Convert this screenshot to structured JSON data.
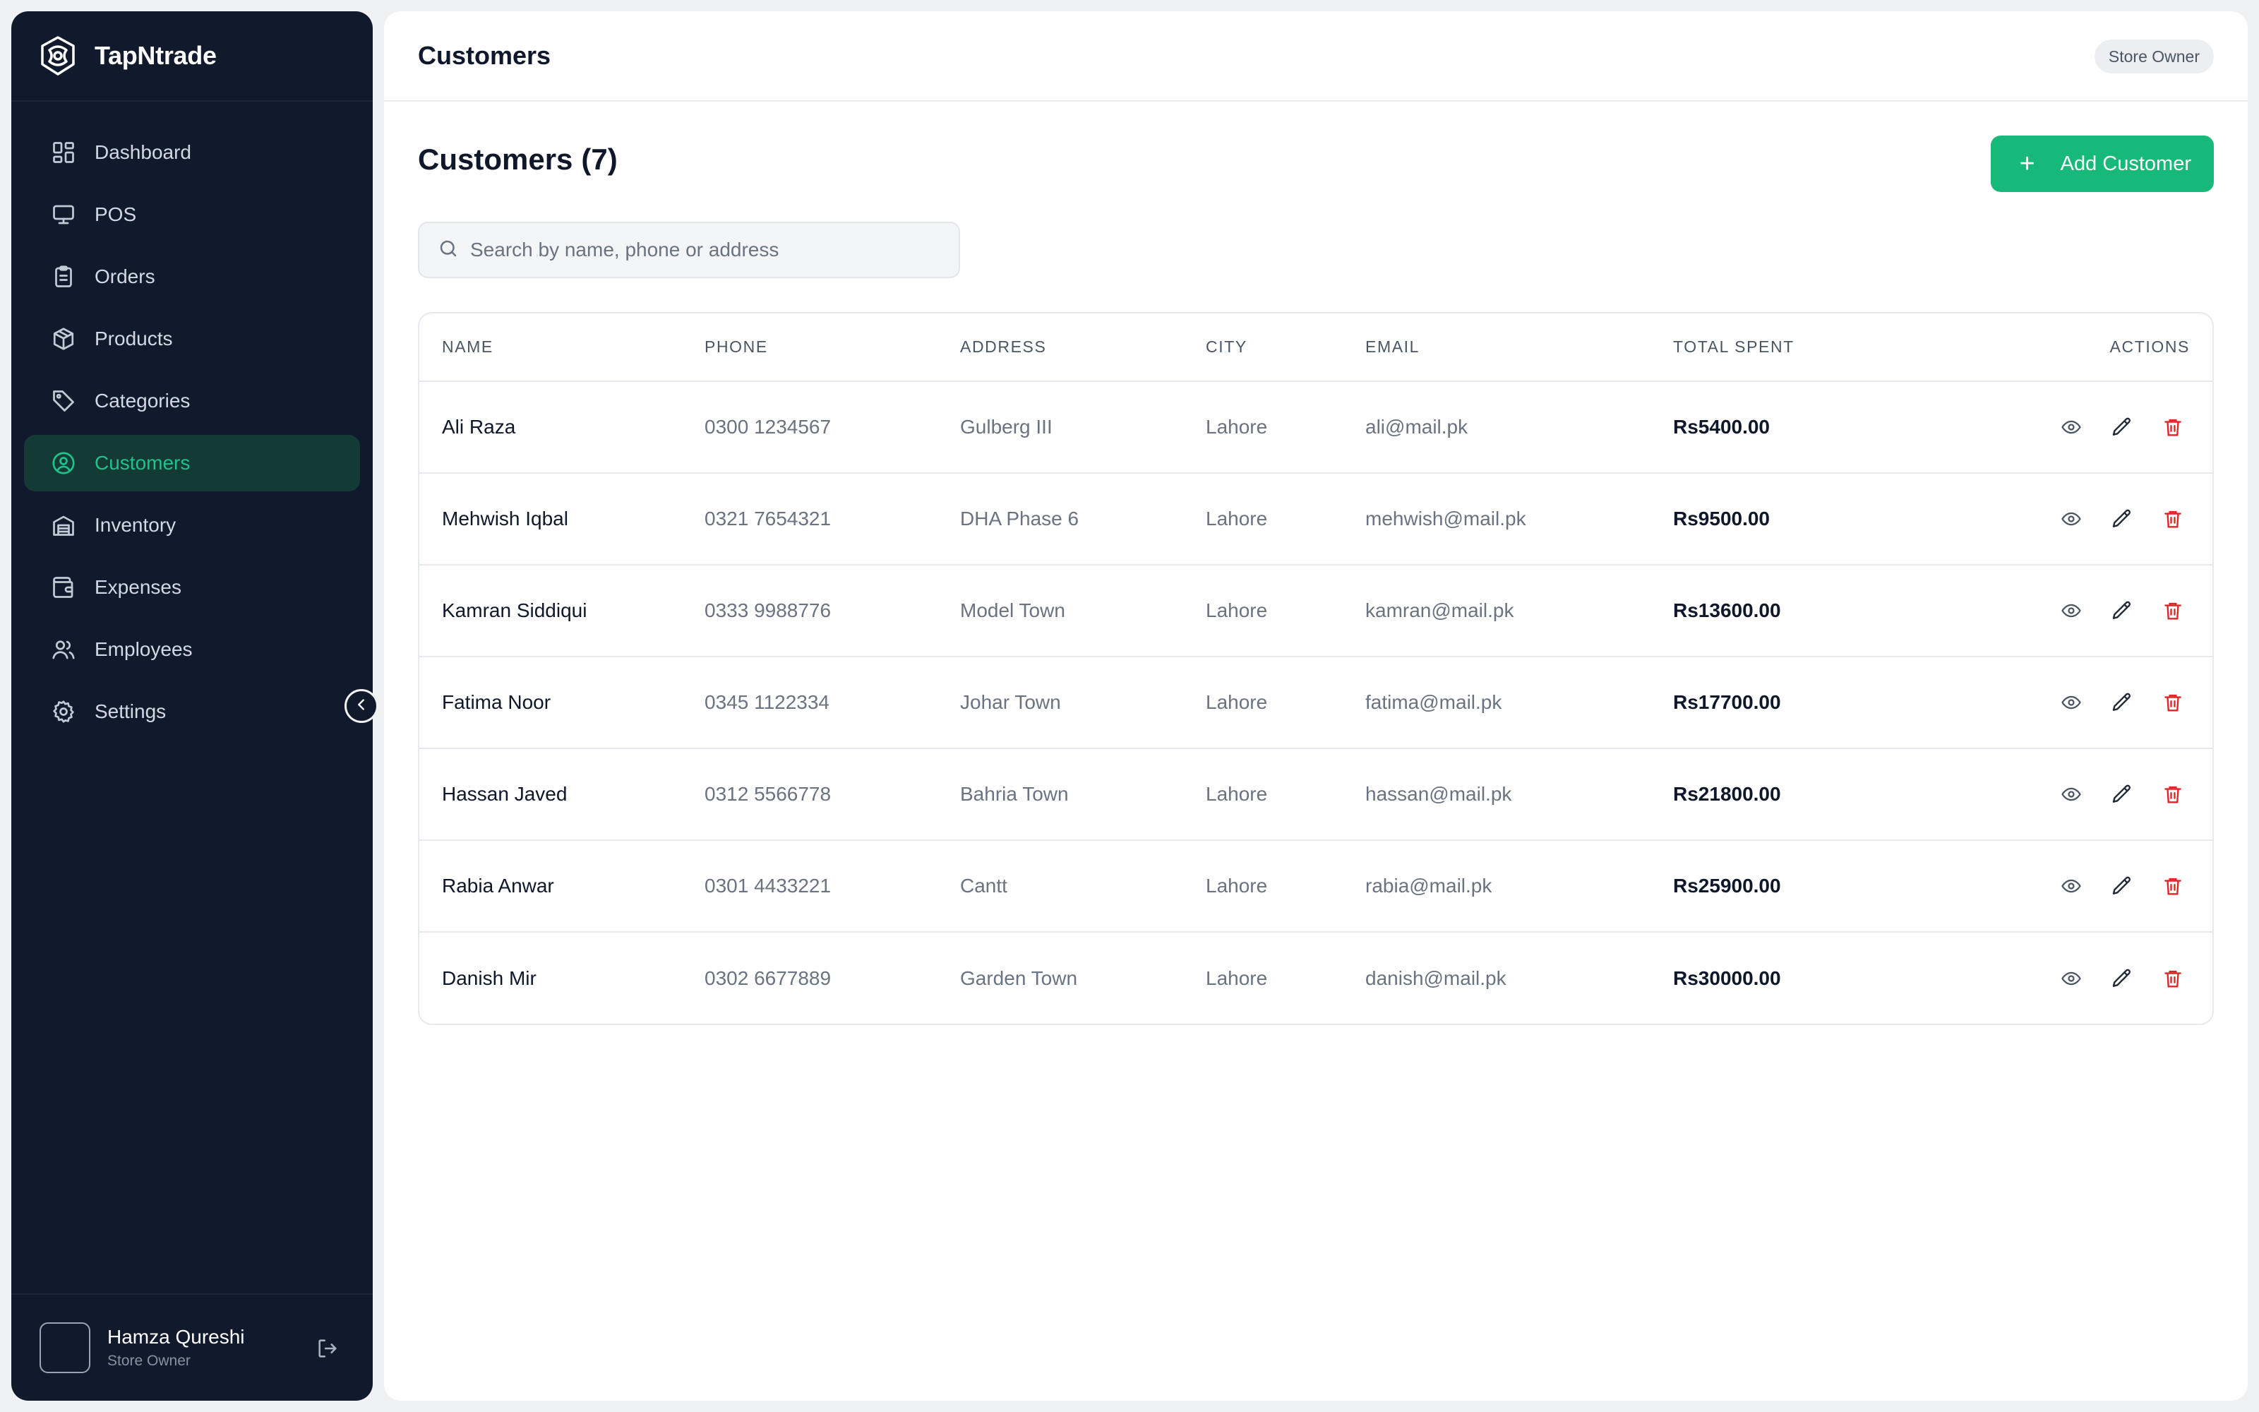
{
  "brand": {
    "name": "TapNtrade"
  },
  "nav": {
    "items": [
      {
        "label": "Dashboard",
        "icon": "dashboard-icon"
      },
      {
        "label": "POS",
        "icon": "monitor-icon"
      },
      {
        "label": "Orders",
        "icon": "clipboard-icon"
      },
      {
        "label": "Products",
        "icon": "package-icon"
      },
      {
        "label": "Categories",
        "icon": "tag-icon"
      },
      {
        "label": "Customers",
        "icon": "user-circle-icon",
        "active": true
      },
      {
        "label": "Inventory",
        "icon": "warehouse-icon"
      },
      {
        "label": "Expenses",
        "icon": "wallet-icon"
      },
      {
        "label": "Employees",
        "icon": "users-icon"
      },
      {
        "label": "Settings",
        "icon": "gear-icon"
      }
    ]
  },
  "user": {
    "name": "Hamza Qureshi",
    "role": "Store Owner"
  },
  "header": {
    "title": "Customers",
    "role_badge": "Store Owner"
  },
  "page": {
    "heading": "Customers",
    "count": "(7)",
    "add_button": "Add Customer"
  },
  "search": {
    "placeholder": "Search by name, phone or address",
    "value": ""
  },
  "table": {
    "columns": {
      "name": "NAME",
      "phone": "PHONE",
      "address": "ADDRESS",
      "city": "CITY",
      "email": "EMAIL",
      "total": "TOTAL SPENT",
      "actions": "ACTIONS"
    },
    "rows": [
      {
        "name": "Ali Raza",
        "phone": "0300 1234567",
        "address": "Gulberg III",
        "city": "Lahore",
        "email": "ali@mail.pk",
        "total": "Rs5400.00"
      },
      {
        "name": "Mehwish Iqbal",
        "phone": "0321 7654321",
        "address": "DHA Phase 6",
        "city": "Lahore",
        "email": "mehwish@mail.pk",
        "total": "Rs9500.00"
      },
      {
        "name": "Kamran Siddiqui",
        "phone": "0333 9988776",
        "address": "Model Town",
        "city": "Lahore",
        "email": "kamran@mail.pk",
        "total": "Rs13600.00"
      },
      {
        "name": "Fatima Noor",
        "phone": "0345 1122334",
        "address": "Johar Town",
        "city": "Lahore",
        "email": "fatima@mail.pk",
        "total": "Rs17700.00"
      },
      {
        "name": "Hassan Javed",
        "phone": "0312 5566778",
        "address": "Bahria Town",
        "city": "Lahore",
        "email": "hassan@mail.pk",
        "total": "Rs21800.00"
      },
      {
        "name": "Rabia Anwar",
        "phone": "0301 4433221",
        "address": "Cantt",
        "city": "Lahore",
        "email": "rabia@mail.pk",
        "total": "Rs25900.00"
      },
      {
        "name": "Danish Mir",
        "phone": "0302 6677889",
        "address": "Garden Town",
        "city": "Lahore",
        "email": "danish@mail.pk",
        "total": "Rs30000.00"
      }
    ]
  },
  "colors": {
    "sidebar_bg": "#111a2c",
    "accent": "#17b978",
    "active_text": "#22c08a",
    "delete": "#dc2626"
  }
}
